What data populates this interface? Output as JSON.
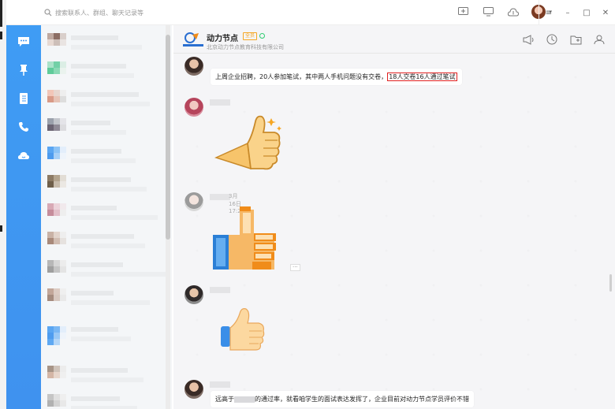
{
  "search": {
    "placeholder": "搜索联系人、群组、聊天记录等"
  },
  "top_icons": [
    "add-icon",
    "screen-icon",
    "cloud-upload-icon"
  ],
  "window_controls": [
    "menu-icon",
    "minimize-icon",
    "maximize-icon",
    "close-icon"
  ],
  "nav": [
    "chat-icon",
    "pin-icon",
    "contacts-book-icon",
    "phone-icon",
    "cloud-icon"
  ],
  "colors": {
    "nav": "#3f97f2",
    "accent_red": "#e02020",
    "badge": "#f5a623",
    "online": "#2ecc71"
  },
  "chat": {
    "group_name": "动力节点",
    "badge": "全员",
    "company": "北京动力节点教育科技有限公司",
    "header_icons": [
      "announcement-icon",
      "history-icon",
      "folder-icon",
      "add-member-icon"
    ],
    "messages": [
      {
        "text": "上周企业招聘，20人参加笔试，其中两人手机问题没有交卷，",
        "highlight": "18人交卷16人通过笔试"
      },
      {
        "sticker": "thumbs-up-cone-sticker"
      },
      {
        "time": "3月16日 17:21",
        "sticker": "pixel-thumbs-up-sticker"
      },
      {
        "sticker": "thumbs-up-emoji-sticker"
      },
      {
        "text_before": "远高于",
        "text_after": "的通过率，就看咱学生的面试表达发挥了，企业目前对动力节点学员评价不错"
      }
    ],
    "more_label": "···"
  }
}
